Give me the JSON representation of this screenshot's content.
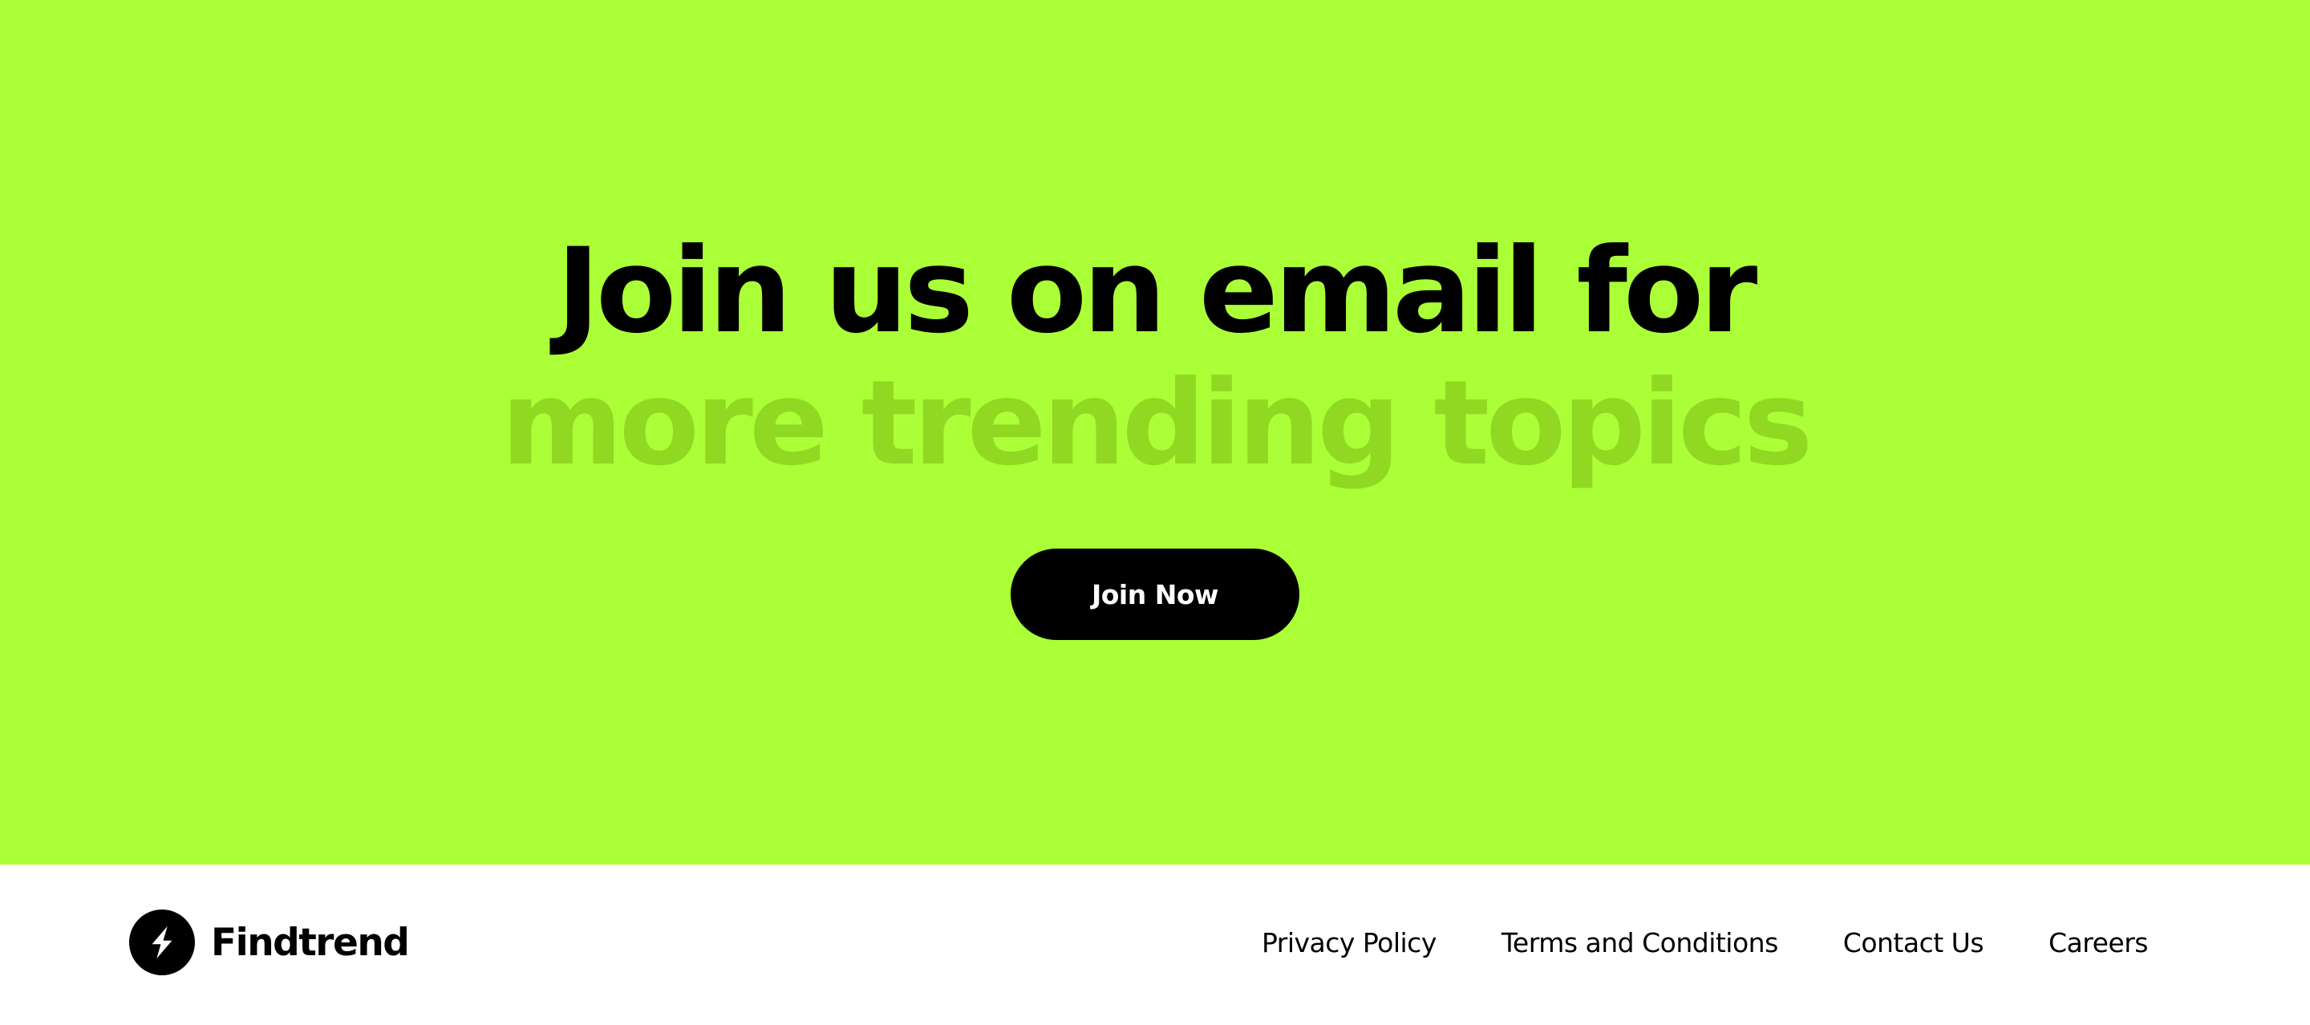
{
  "hero": {
    "headline_line1": "Join us on email for",
    "headline_line2": "more trending topics",
    "cta_label": "Join Now",
    "background_color": "#abff37",
    "accent_text_color": "#91d823"
  },
  "footer": {
    "brand_name": "Findtrend",
    "logo_icon": "lightning-bolt-icon",
    "links": [
      {
        "label": "Privacy Policy"
      },
      {
        "label": "Terms and Conditions"
      },
      {
        "label": "Contact Us"
      },
      {
        "label": "Careers"
      }
    ]
  }
}
